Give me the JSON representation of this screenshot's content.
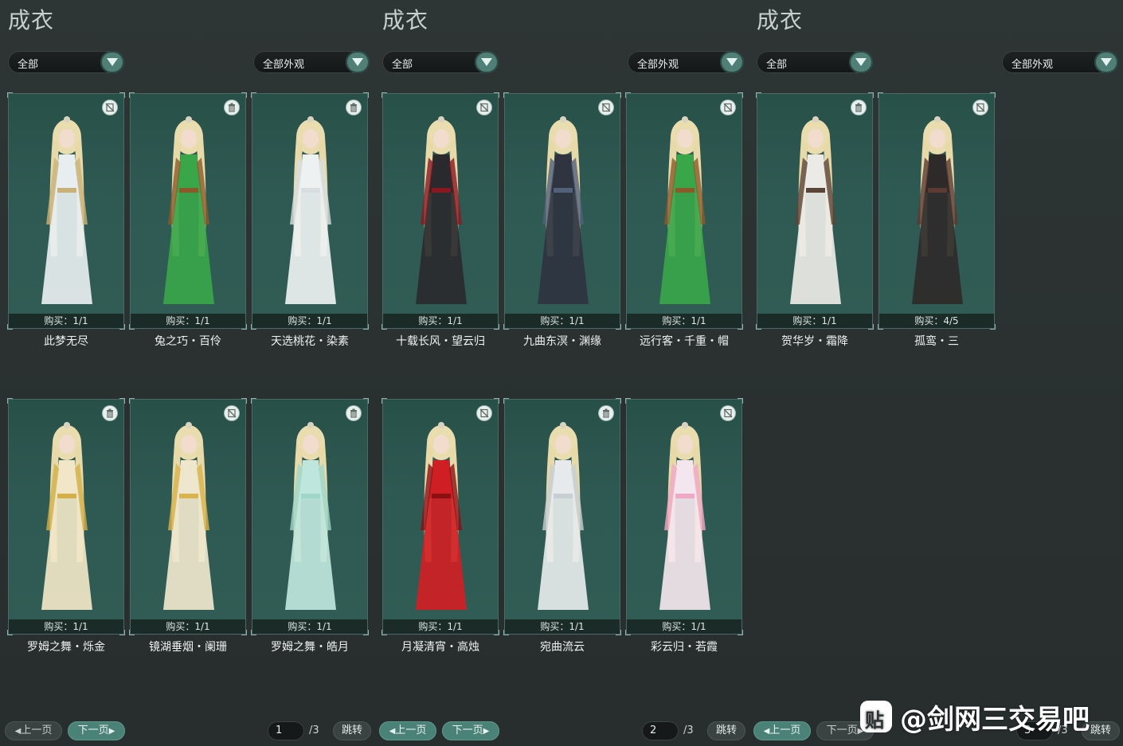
{
  "panels": [
    {
      "title": "成衣",
      "filter_left": "全部",
      "filter_right": "全部外观",
      "page_current": "1",
      "page_total": "/3",
      "prev_label": "上一页",
      "next_label": "下一页",
      "jump_label": "跳转",
      "items": [
        {
          "name": "此梦无尽",
          "buy": "购买：1/1",
          "icon": "hide-icon",
          "outfit": "#e8eef0",
          "accent": "#c9b27a"
        },
        {
          "name": "兔之巧・百伶",
          "buy": "购买：1/1",
          "icon": "trash-icon",
          "outfit": "#3aa64a",
          "accent": "#8b5a2b"
        },
        {
          "name": "天选桃花・染素",
          "buy": "购买：1/1",
          "icon": "trash-icon",
          "outfit": "#eef1f2",
          "accent": "#d8dde0"
        },
        {
          "name": "罗姆之舞・烁金",
          "buy": "购买：1/1",
          "icon": "trash-icon",
          "outfit": "#f1e6c8",
          "accent": "#d3b04a"
        },
        {
          "name": "镜湖垂烟・阑珊",
          "buy": "购买：1/1",
          "icon": "hide-icon",
          "outfit": "#efe7cd",
          "accent": "#d9b34e"
        },
        {
          "name": "罗姆之舞・皓月",
          "buy": "购买：1/1",
          "icon": "trash-icon",
          "outfit": "#bfe6dc",
          "accent": "#9fd6c8"
        }
      ]
    },
    {
      "title": "成衣",
      "filter_left": "全部",
      "filter_right": "全部外观",
      "page_current": "2",
      "page_total": "/3",
      "prev_label": "上一页",
      "next_label": "下一页",
      "jump_label": "跳转",
      "items": [
        {
          "name": "十载长风・望云归",
          "buy": "购买：1/1",
          "icon": "hide-icon",
          "outfit": "#2a2a2e",
          "accent": "#8a1620"
        },
        {
          "name": "九曲东溟・渊缘",
          "buy": "购买：1/1",
          "icon": "hide-icon",
          "outfit": "#2f3440",
          "accent": "#53607a"
        },
        {
          "name": "远行客・千重・帽",
          "buy": "购买：1/1",
          "icon": "hide-icon",
          "outfit": "#3aa64a",
          "accent": "#8b5a2b"
        },
        {
          "name": "月凝清宵・高烛",
          "buy": "购买：1/1",
          "icon": "hide-icon",
          "outfit": "#d01f24",
          "accent": "#8c0f14"
        },
        {
          "name": "宛曲流云",
          "buy": "购买：1/1",
          "icon": "trash-icon",
          "outfit": "#e7eaec",
          "accent": "#c8ced2"
        },
        {
          "name": "彩云归・若霞",
          "buy": "购买：1/1",
          "icon": "hide-icon",
          "outfit": "#f4e6ee",
          "accent": "#f0a9c4"
        }
      ]
    },
    {
      "title": "成衣",
      "filter_left": "全部",
      "filter_right": "全部外观",
      "page_current": "3",
      "page_total": "/3",
      "prev_label": "上一页",
      "next_label": "下一页",
      "jump_label": "跳转",
      "items": [
        {
          "name": "贺华岁・霜降",
          "buy": "购买：1/1",
          "icon": "trash-icon",
          "outfit": "#ebeae6",
          "accent": "#5b4538"
        },
        {
          "name": "孤鸾・三",
          "buy": "购买：4/5",
          "icon": "hide-icon",
          "outfit": "#2e2a2a",
          "accent": "#5a3a32"
        }
      ]
    }
  ],
  "watermark": {
    "badge": "贴",
    "text": "@剑网三交易吧"
  }
}
